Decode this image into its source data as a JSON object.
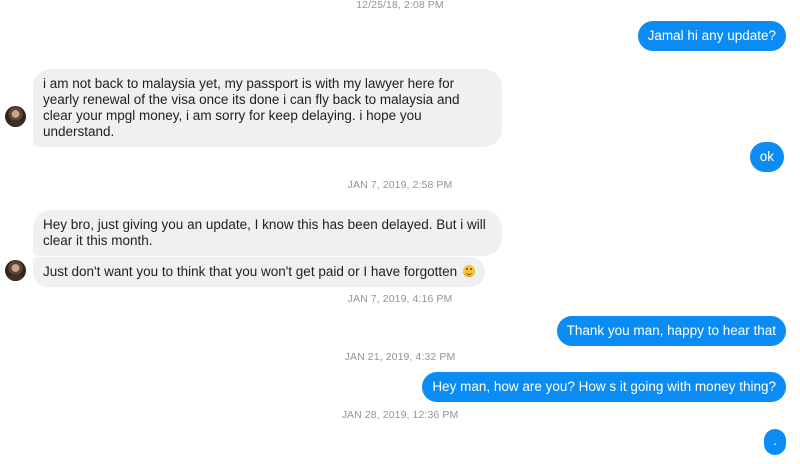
{
  "colors": {
    "outgoing": "#0b8cf5",
    "incoming": "#f1f0f0",
    "timestamp": "#90949c"
  },
  "timestamps": [
    "12/25/18, 2:08 PM",
    "JAN 7, 2019, 2:58 PM",
    "JAN 7, 2019, 4:16 PM",
    "JAN 21, 2019, 4:32 PM",
    "JAN 28, 2019, 12:36 PM"
  ],
  "messages": [
    {
      "direction": "outgoing",
      "text": "Jamal hi any update?"
    },
    {
      "direction": "incoming",
      "text": "i am not back to malaysia yet, my passport is with my lawyer here for yearly renewal of the visa once its done i can fly back to malaysia and clear your mpgl money, i am sorry for keep delaying. i hope you understand."
    },
    {
      "direction": "outgoing",
      "text": "ok"
    },
    {
      "direction": "incoming",
      "text": "Hey bro, just giving you an update, I know this has been delayed. But i will clear it this month."
    },
    {
      "direction": "incoming",
      "text": "Just don't want you to think that you won't get paid or I have forgotten",
      "emoji": "smiley-emoji"
    },
    {
      "direction": "outgoing",
      "text": "Thank you man, happy to hear that"
    },
    {
      "direction": "outgoing",
      "text": "Hey man, how are you? How s it going with money thing?"
    },
    {
      "direction": "outgoing",
      "text": "."
    }
  ]
}
